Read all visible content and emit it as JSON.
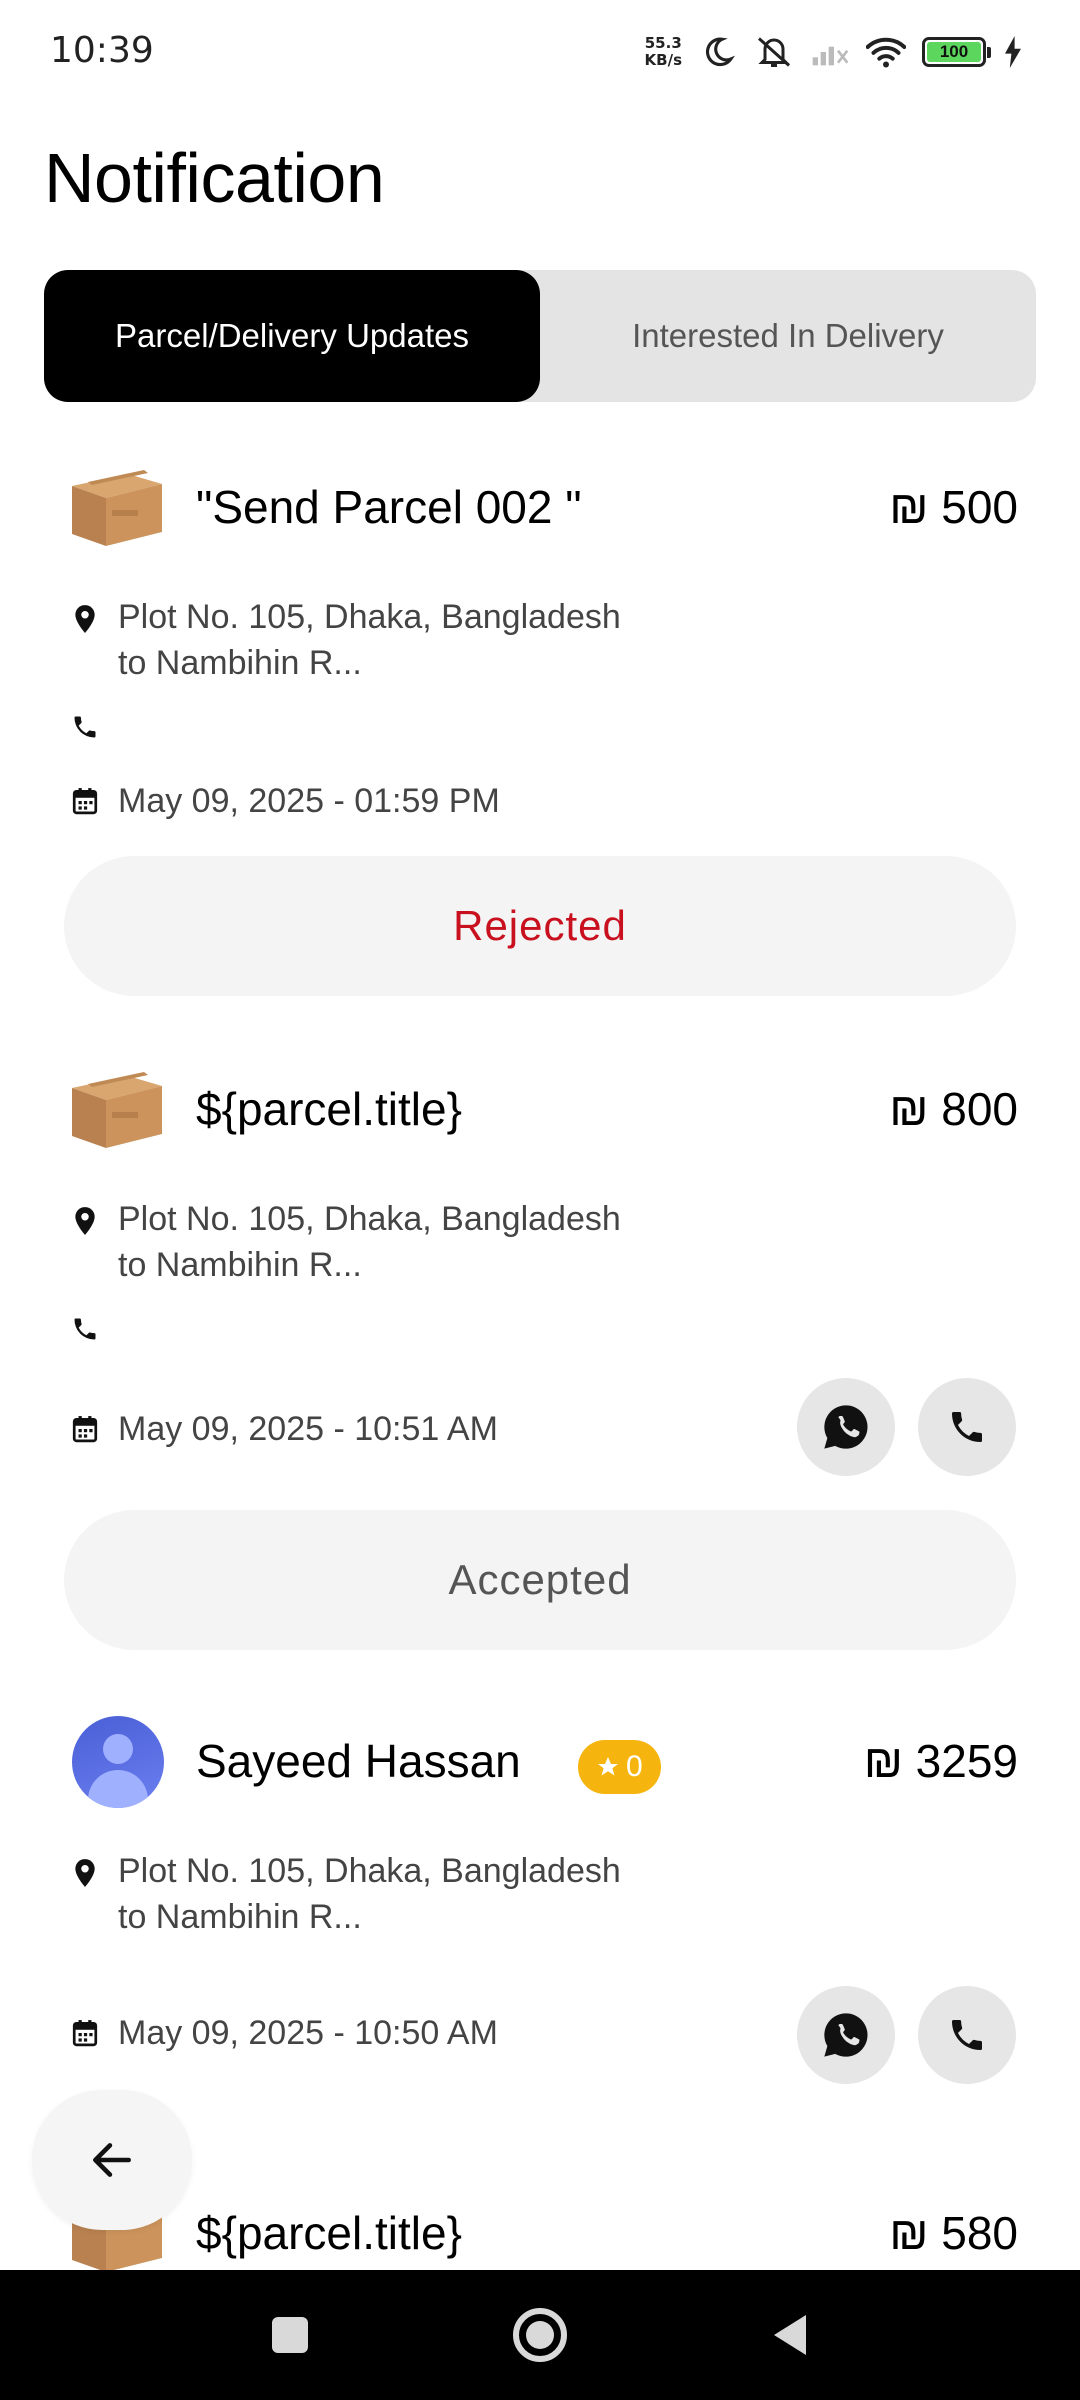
{
  "status_bar": {
    "time": "10:39",
    "net_speed_value": "55.3",
    "net_speed_unit": "KB/s",
    "battery": "100",
    "icons": [
      "moon-icon",
      "mute-icon",
      "signal-icon",
      "wifi-icon",
      "battery-icon",
      "charging-icon"
    ]
  },
  "header": {
    "title": "Notification"
  },
  "tabs": [
    {
      "label": "Parcel/Delivery Updates",
      "active": true
    },
    {
      "label": "Interested In Delivery",
      "active": false
    }
  ],
  "currency_symbol": "₪",
  "cards": [
    {
      "thumb": "parcel-box",
      "title": "\"Send Parcel 002 \"",
      "price": "₪ 500",
      "address": "Plot No. 105, Dhaka, Bangladesh to Nambihin R...",
      "date": "May 09, 2025 - 01:59 PM",
      "status": "Rejected",
      "status_color": "#c8101e"
    },
    {
      "thumb": "parcel-box",
      "title": "${parcel.title}",
      "price": "₪ 800",
      "address": "Plot No. 105, Dhaka, Bangladesh to Nambihin R...",
      "date": "May 09, 2025 - 10:51 AM",
      "status": "Accepted",
      "status_color": "#555555"
    },
    {
      "thumb": "avatar",
      "title": "Sayeed Hassan",
      "rating": "0",
      "price": "₪ 3259",
      "address": "Plot No. 105, Dhaka, Bangladesh to Nambihin R...",
      "date": "May 09, 2025 - 10:50 AM"
    },
    {
      "thumb": "parcel-box",
      "title": "${parcel.title}",
      "price": "₪ 580"
    }
  ],
  "colors": {
    "accent": "#000000",
    "tab_inactive_bg": "#e4e4e4",
    "rating_badge": "#f6b40e",
    "rejected": "#c8101e"
  }
}
